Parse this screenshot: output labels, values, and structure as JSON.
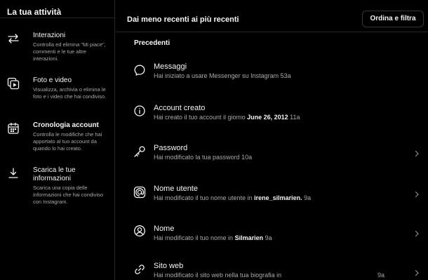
{
  "sidebar": {
    "title": "La tua attività",
    "items": [
      {
        "label": "Interazioni",
        "desc": "Controlla ed elimina \"Mi piace\", commenti e le tue altre interazioni.",
        "icon": "interactions-icon"
      },
      {
        "label": "Foto e video",
        "desc": "Visualizza, archivia o elimina le foto e i video che hai condiviso.",
        "icon": "photo-video-icon"
      },
      {
        "label": "Cronologia account",
        "desc": "Controlla le modifiche che hai apportato al tuo account da quando lo hai creato.",
        "icon": "calendar-icon",
        "active": true
      },
      {
        "label": "Scarica le tue informazioni",
        "desc": "Scarica una copia delle informazioni che hai condiviso con Instagram.",
        "icon": "download-icon"
      }
    ]
  },
  "header": {
    "sort_label": "Dai meno recenti ai più recenti",
    "filter_button": "Ordina e filtra"
  },
  "section_label": "Precedenti",
  "entries": [
    {
      "title": "Messaggi",
      "pre": "Hai iniziato a usare Messenger su Instagram",
      "bold": "",
      "time": "53a",
      "icon": "messenger-icon",
      "chevron": false
    },
    {
      "title": "Account creato",
      "pre": "Hai creato il tuo account il giorno",
      "bold": "June 26, 2012",
      "time": "11a",
      "icon": "info-icon",
      "chevron": false
    },
    {
      "title": "Password",
      "pre": "Hai modificato la tua password",
      "bold": "",
      "time": "10a",
      "icon": "key-icon",
      "chevron": true
    },
    {
      "title": "Nome utente",
      "pre": "Hai modificato il tuo nome utente in",
      "bold": "irene_silmarien.",
      "time": "9a",
      "icon": "username-icon",
      "chevron": true
    },
    {
      "title": "Nome",
      "pre": "Hai modificato il tuo nome in",
      "bold": "Silmarien",
      "time": "9a",
      "icon": "user-icon",
      "chevron": true
    },
    {
      "title": "Sito web",
      "pre": "Hai modificato il sito web nella tua biografia in",
      "bold": "",
      "time": "9a",
      "icon": "link-icon",
      "chevron": true
    }
  ]
}
